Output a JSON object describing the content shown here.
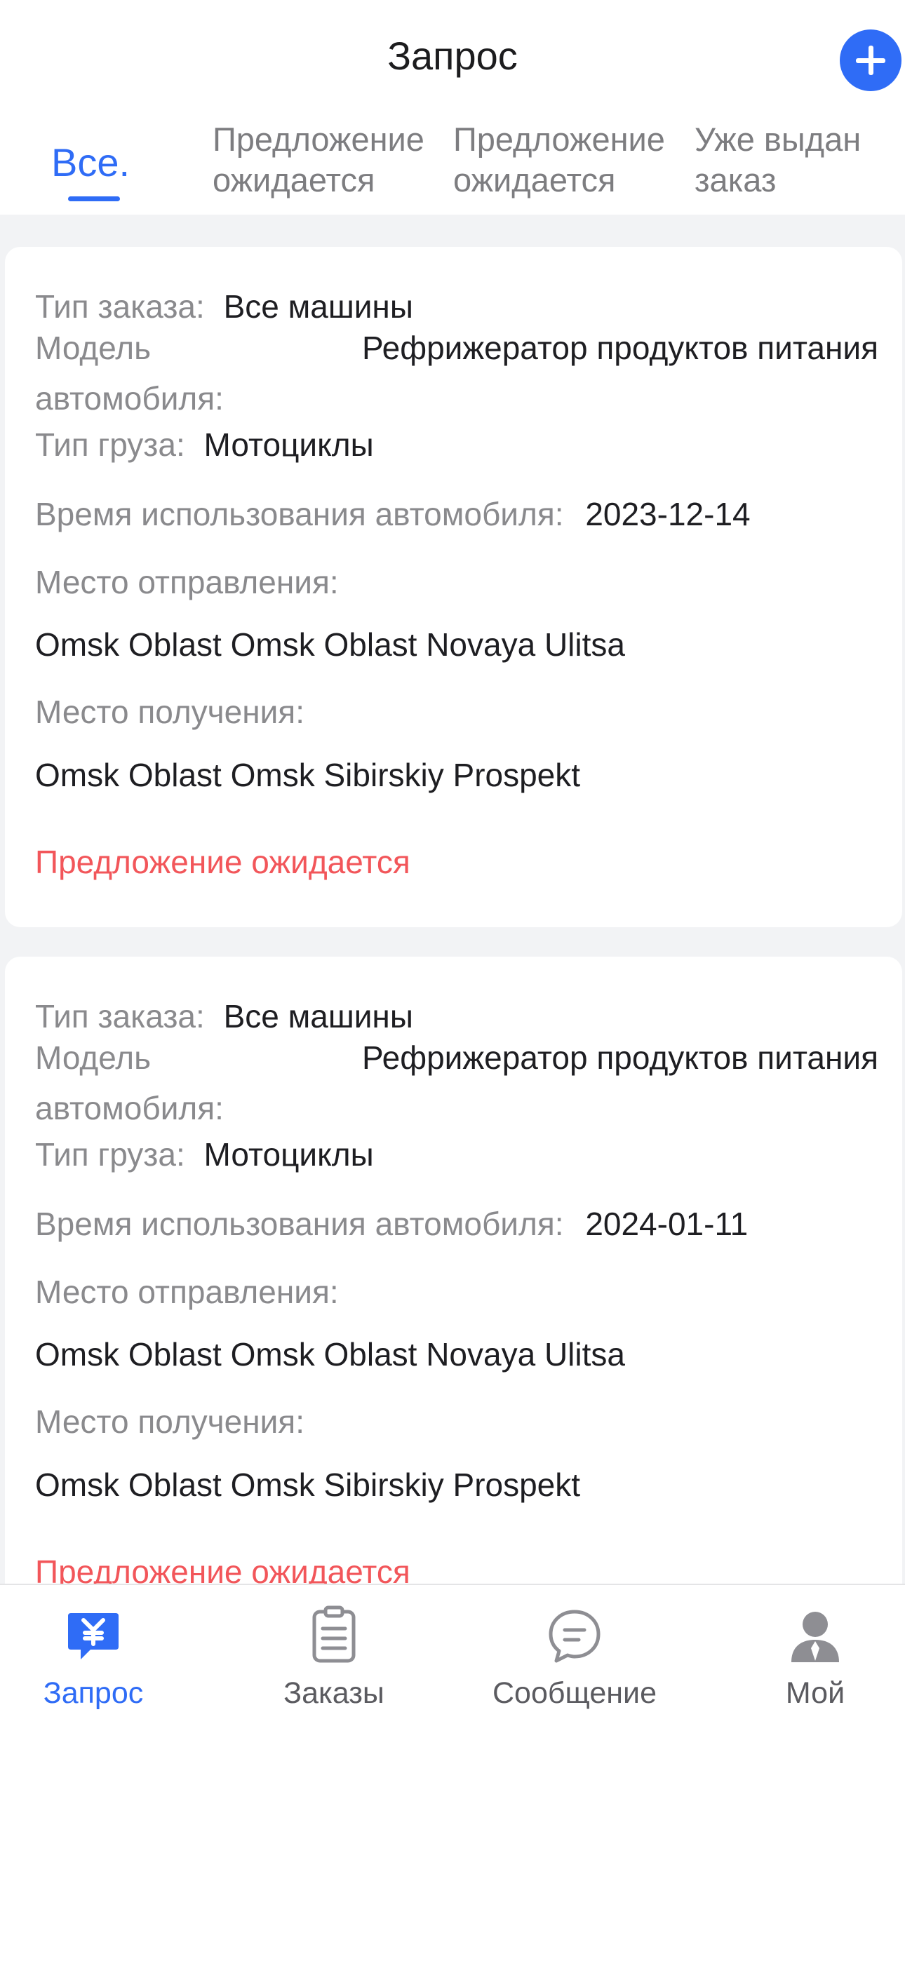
{
  "header": {
    "title": "Запрос"
  },
  "tabs": [
    {
      "label": "Все."
    },
    {
      "label": "Предложение ожидается"
    },
    {
      "label": "Предложение ожидается"
    },
    {
      "label": "Уже выдан заказ"
    }
  ],
  "labels": {
    "order_type": "Тип заказа:",
    "car_model": "Модель автомобиля:",
    "cargo_type": "Тип груза:",
    "use_time": "Время использования автомобиля:",
    "departure": "Место отправления:",
    "arrival": "Место получения:"
  },
  "orders": [
    {
      "order_type": "Все машины",
      "car_model": "Рефрижератор продуктов питания",
      "cargo_type": "Мотоциклы",
      "use_time": "2023-12-14",
      "departure": "Omsk Oblast Omsk Oblast Novaya Ulitsa",
      "arrival": "Omsk Oblast Omsk Sibirskiy Prospekt",
      "status": "Предложение ожидается"
    },
    {
      "order_type": "Все машины",
      "car_model": "Рефрижератор продуктов питания",
      "cargo_type": "Мотоциклы",
      "use_time": "2024-01-11",
      "departure": "Omsk Oblast Omsk Oblast Novaya Ulitsa",
      "arrival": "Omsk Oblast Omsk Sibirskiy Prospekt",
      "status": "Предложение ожидается"
    }
  ],
  "bottom_nav": [
    {
      "label": "Запрос",
      "icon": "request-icon"
    },
    {
      "label": "Заказы",
      "icon": "orders-icon"
    },
    {
      "label": "Сообщение",
      "icon": "message-icon"
    },
    {
      "label": "Мой",
      "icon": "profile-icon"
    }
  ],
  "colors": {
    "accent": "#2f6cf6",
    "status_pending": "#f2565a",
    "label_gray": "#8a8a8d",
    "background": "#f2f3f5"
  }
}
